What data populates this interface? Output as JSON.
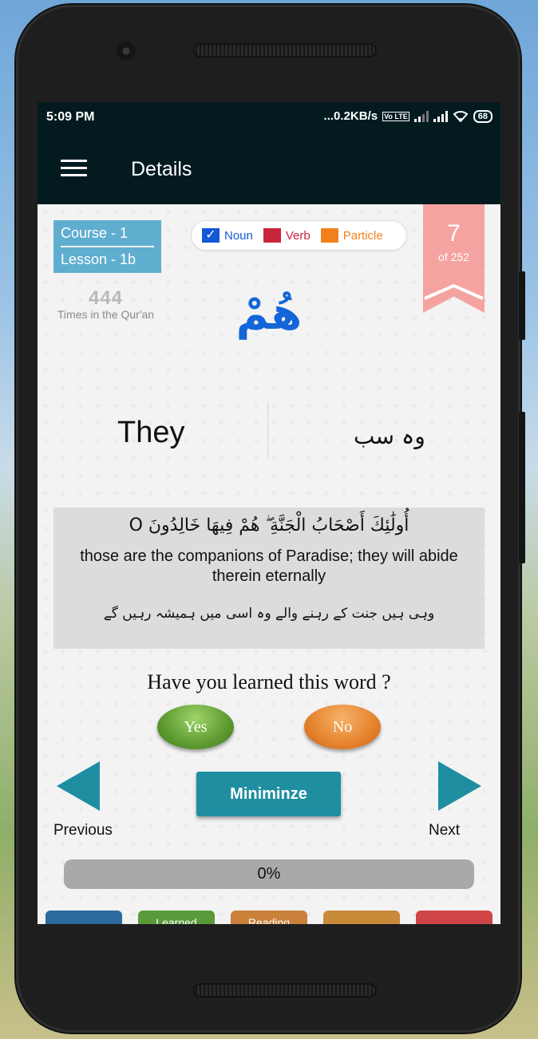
{
  "status_bar": {
    "time": "5:09 PM",
    "net_speed": "...0.2KB/s",
    "volte": "Vo LTE",
    "battery": "68"
  },
  "app_bar": {
    "title": "Details",
    "menu_icon": "hamburger-menu-icon"
  },
  "course": {
    "course_label": "Course - 1",
    "lesson_label": "Lesson - 1b"
  },
  "frequency": {
    "count": "444",
    "label": "Times in the Qur'an"
  },
  "legend": {
    "items": [
      {
        "label": "Noun",
        "color": "#1558d6",
        "checked": true
      },
      {
        "label": "Verb",
        "color": "#c8243a",
        "checked": false
      },
      {
        "label": "Particle",
        "color": "#f2811d",
        "checked": false
      }
    ]
  },
  "word_counter": {
    "current": "7",
    "total_label": "of 252"
  },
  "word": {
    "arabic": "هُمْ",
    "english": "They",
    "urdu": "وہ سب"
  },
  "verse": {
    "arabic": "أُولَٰئِكَ أَصْحَابُ الْجَنَّةِ ۖ هُمْ فِيهَا خَالِدُونَ O",
    "english": "those are the companions of Paradise; they will abide therein eternally",
    "urdu": "وہی ہیں جنت کے رہنے والے وہ اسی میں ہمیشہ رہیں گے"
  },
  "quiz": {
    "question": "Have you learned this word ?",
    "yes_label": "Yes",
    "no_label": "No"
  },
  "navigation": {
    "previous_label": "Previous",
    "next_label": "Next",
    "minimize_label": "Miniminze"
  },
  "progress": {
    "value": 0,
    "label": "0%"
  },
  "bottom_tabs": [
    {
      "label": "",
      "color": "#2c6aa0"
    },
    {
      "label": "Learned",
      "color": "#5a9a3a"
    },
    {
      "label": "Reading",
      "color": "#c9813a"
    },
    {
      "label": "",
      "color": "#c98a3a"
    },
    {
      "label": "",
      "color": "#d04646"
    }
  ],
  "colors": {
    "appbar": "#031b1f",
    "accent_teal": "#1f8ea1",
    "course_box": "#5faed0",
    "ribbon": "#f5a3a0",
    "word_blue": "#1466d8"
  }
}
